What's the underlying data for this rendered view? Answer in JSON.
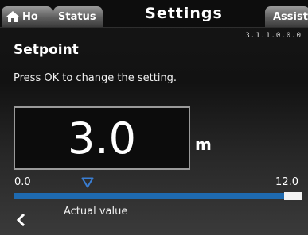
{
  "tabs": {
    "home_label": "Ho",
    "status_label": "Status",
    "settings_label": "Settings",
    "assist_label": "Assist"
  },
  "menu_code": "3.1.1.0.0.0",
  "page": {
    "title": "Setpoint",
    "instruction": "Press OK to change the setting."
  },
  "setpoint": {
    "value": "3.0",
    "unit": "m",
    "scale_min": "0.0",
    "scale_max": "12.0",
    "actual_value_label": "Actual value"
  },
  "icons": {
    "home": "home-icon",
    "actual_marker": "triangle-down-icon",
    "back": "chevron-left-icon"
  },
  "colors": {
    "accent_blue": "#1e6ab0",
    "marker_blue": "#3a7fd5",
    "tab_grey": "#6a6a6a",
    "background": "#121212"
  }
}
